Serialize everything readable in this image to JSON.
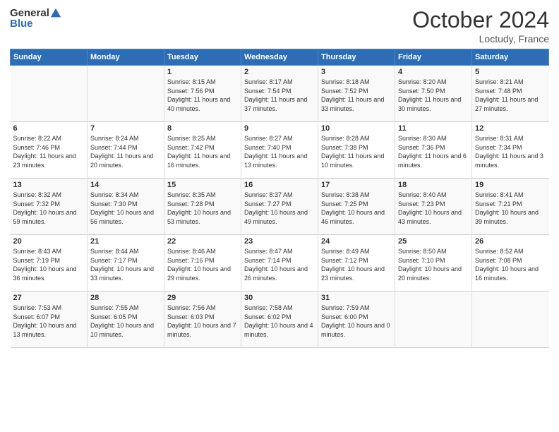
{
  "header": {
    "logo_general": "General",
    "logo_blue": "Blue",
    "month_title": "October 2024",
    "location": "Loctudy, France"
  },
  "weekdays": [
    "Sunday",
    "Monday",
    "Tuesday",
    "Wednesday",
    "Thursday",
    "Friday",
    "Saturday"
  ],
  "weeks": [
    [
      {
        "day": "",
        "sunrise": "",
        "sunset": "",
        "daylight": ""
      },
      {
        "day": "",
        "sunrise": "",
        "sunset": "",
        "daylight": ""
      },
      {
        "day": "1",
        "sunrise": "Sunrise: 8:15 AM",
        "sunset": "Sunset: 7:56 PM",
        "daylight": "Daylight: 11 hours and 40 minutes."
      },
      {
        "day": "2",
        "sunrise": "Sunrise: 8:17 AM",
        "sunset": "Sunset: 7:54 PM",
        "daylight": "Daylight: 11 hours and 37 minutes."
      },
      {
        "day": "3",
        "sunrise": "Sunrise: 8:18 AM",
        "sunset": "Sunset: 7:52 PM",
        "daylight": "Daylight: 11 hours and 33 minutes."
      },
      {
        "day": "4",
        "sunrise": "Sunrise: 8:20 AM",
        "sunset": "Sunset: 7:50 PM",
        "daylight": "Daylight: 11 hours and 30 minutes."
      },
      {
        "day": "5",
        "sunrise": "Sunrise: 8:21 AM",
        "sunset": "Sunset: 7:48 PM",
        "daylight": "Daylight: 11 hours and 27 minutes."
      }
    ],
    [
      {
        "day": "6",
        "sunrise": "Sunrise: 8:22 AM",
        "sunset": "Sunset: 7:46 PM",
        "daylight": "Daylight: 11 hours and 23 minutes."
      },
      {
        "day": "7",
        "sunrise": "Sunrise: 8:24 AM",
        "sunset": "Sunset: 7:44 PM",
        "daylight": "Daylight: 11 hours and 20 minutes."
      },
      {
        "day": "8",
        "sunrise": "Sunrise: 8:25 AM",
        "sunset": "Sunset: 7:42 PM",
        "daylight": "Daylight: 11 hours and 16 minutes."
      },
      {
        "day": "9",
        "sunrise": "Sunrise: 8:27 AM",
        "sunset": "Sunset: 7:40 PM",
        "daylight": "Daylight: 11 hours and 13 minutes."
      },
      {
        "day": "10",
        "sunrise": "Sunrise: 8:28 AM",
        "sunset": "Sunset: 7:38 PM",
        "daylight": "Daylight: 11 hours and 10 minutes."
      },
      {
        "day": "11",
        "sunrise": "Sunrise: 8:30 AM",
        "sunset": "Sunset: 7:36 PM",
        "daylight": "Daylight: 11 hours and 6 minutes."
      },
      {
        "day": "12",
        "sunrise": "Sunrise: 8:31 AM",
        "sunset": "Sunset: 7:34 PM",
        "daylight": "Daylight: 11 hours and 3 minutes."
      }
    ],
    [
      {
        "day": "13",
        "sunrise": "Sunrise: 8:32 AM",
        "sunset": "Sunset: 7:32 PM",
        "daylight": "Daylight: 10 hours and 59 minutes."
      },
      {
        "day": "14",
        "sunrise": "Sunrise: 8:34 AM",
        "sunset": "Sunset: 7:30 PM",
        "daylight": "Daylight: 10 hours and 56 minutes."
      },
      {
        "day": "15",
        "sunrise": "Sunrise: 8:35 AM",
        "sunset": "Sunset: 7:28 PM",
        "daylight": "Daylight: 10 hours and 53 minutes."
      },
      {
        "day": "16",
        "sunrise": "Sunrise: 8:37 AM",
        "sunset": "Sunset: 7:27 PM",
        "daylight": "Daylight: 10 hours and 49 minutes."
      },
      {
        "day": "17",
        "sunrise": "Sunrise: 8:38 AM",
        "sunset": "Sunset: 7:25 PM",
        "daylight": "Daylight: 10 hours and 46 minutes."
      },
      {
        "day": "18",
        "sunrise": "Sunrise: 8:40 AM",
        "sunset": "Sunset: 7:23 PM",
        "daylight": "Daylight: 10 hours and 43 minutes."
      },
      {
        "day": "19",
        "sunrise": "Sunrise: 8:41 AM",
        "sunset": "Sunset: 7:21 PM",
        "daylight": "Daylight: 10 hours and 39 minutes."
      }
    ],
    [
      {
        "day": "20",
        "sunrise": "Sunrise: 8:43 AM",
        "sunset": "Sunset: 7:19 PM",
        "daylight": "Daylight: 10 hours and 36 minutes."
      },
      {
        "day": "21",
        "sunrise": "Sunrise: 8:44 AM",
        "sunset": "Sunset: 7:17 PM",
        "daylight": "Daylight: 10 hours and 33 minutes."
      },
      {
        "day": "22",
        "sunrise": "Sunrise: 8:46 AM",
        "sunset": "Sunset: 7:16 PM",
        "daylight": "Daylight: 10 hours and 29 minutes."
      },
      {
        "day": "23",
        "sunrise": "Sunrise: 8:47 AM",
        "sunset": "Sunset: 7:14 PM",
        "daylight": "Daylight: 10 hours and 26 minutes."
      },
      {
        "day": "24",
        "sunrise": "Sunrise: 8:49 AM",
        "sunset": "Sunset: 7:12 PM",
        "daylight": "Daylight: 10 hours and 23 minutes."
      },
      {
        "day": "25",
        "sunrise": "Sunrise: 8:50 AM",
        "sunset": "Sunset: 7:10 PM",
        "daylight": "Daylight: 10 hours and 20 minutes."
      },
      {
        "day": "26",
        "sunrise": "Sunrise: 8:52 AM",
        "sunset": "Sunset: 7:08 PM",
        "daylight": "Daylight: 10 hours and 16 minutes."
      }
    ],
    [
      {
        "day": "27",
        "sunrise": "Sunrise: 7:53 AM",
        "sunset": "Sunset: 6:07 PM",
        "daylight": "Daylight: 10 hours and 13 minutes."
      },
      {
        "day": "28",
        "sunrise": "Sunrise: 7:55 AM",
        "sunset": "Sunset: 6:05 PM",
        "daylight": "Daylight: 10 hours and 10 minutes."
      },
      {
        "day": "29",
        "sunrise": "Sunrise: 7:56 AM",
        "sunset": "Sunset: 6:03 PM",
        "daylight": "Daylight: 10 hours and 7 minutes."
      },
      {
        "day": "30",
        "sunrise": "Sunrise: 7:58 AM",
        "sunset": "Sunset: 6:02 PM",
        "daylight": "Daylight: 10 hours and 4 minutes."
      },
      {
        "day": "31",
        "sunrise": "Sunrise: 7:59 AM",
        "sunset": "Sunset: 6:00 PM",
        "daylight": "Daylight: 10 hours and 0 minutes."
      },
      {
        "day": "",
        "sunrise": "",
        "sunset": "",
        "daylight": ""
      },
      {
        "day": "",
        "sunrise": "",
        "sunset": "",
        "daylight": ""
      }
    ]
  ]
}
